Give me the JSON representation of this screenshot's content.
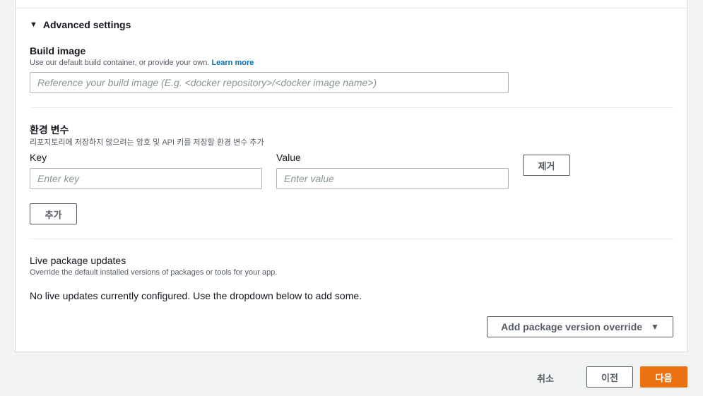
{
  "advanced": {
    "toggle_label": "Advanced settings"
  },
  "build_image": {
    "label": "Build image",
    "description": "Use our default build container, or provide your own.",
    "learn_more": "Learn more",
    "placeholder": "Reference your build image (E.g. <docker repository>/<docker image name>)",
    "value": ""
  },
  "env_vars": {
    "label": "환경 변수",
    "description": "리포지토리에 저장하지 않으려는 암호 및 API 키를 저장할 환경 변수 추가",
    "key_label": "Key",
    "value_label": "Value",
    "key_placeholder": "Enter key",
    "value_placeholder": "Enter value",
    "remove_label": "제거",
    "add_label": "추가"
  },
  "live_updates": {
    "label": "Live package updates",
    "description": "Override the default installed versions of packages or tools for your app.",
    "empty_message": "No live updates currently configured. Use the dropdown below to add some.",
    "dropdown_label": "Add package version override"
  },
  "footer": {
    "cancel_label": "취소",
    "prev_label": "이전",
    "next_label": "다음"
  },
  "colors": {
    "primary": "#ec7211",
    "link": "#0073bb",
    "border": "#aab7b8"
  }
}
